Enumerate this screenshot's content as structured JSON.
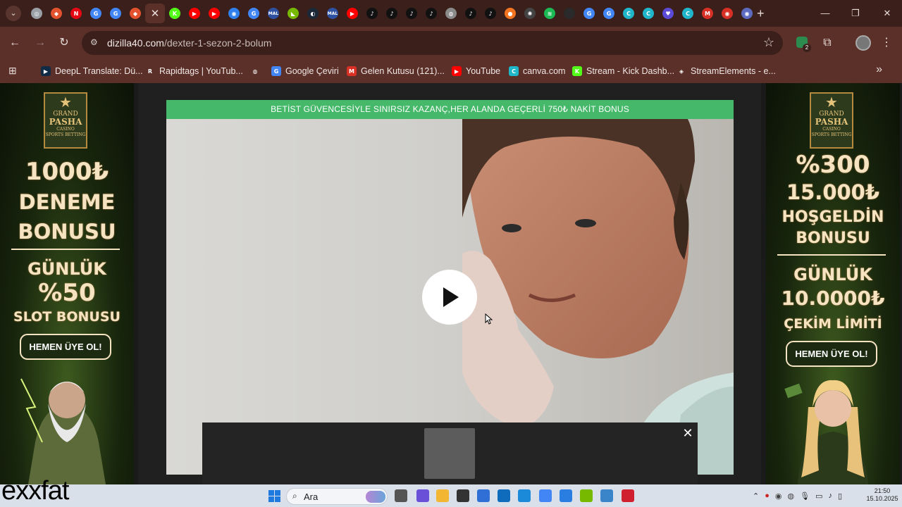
{
  "browser": {
    "tabs": [
      {
        "icon": "chrome-icon",
        "color": "#9aa0a6",
        "glyph": "◎"
      },
      {
        "icon": "game-icon",
        "color": "#e2522f",
        "glyph": "◆"
      },
      {
        "icon": "netflix-icon",
        "color": "#e50914",
        "glyph": "N"
      },
      {
        "icon": "google-icon",
        "color": "#4285f4",
        "glyph": "G"
      },
      {
        "icon": "google-icon",
        "color": "#4285f4",
        "glyph": "G"
      },
      {
        "icon": "game-icon",
        "color": "#e2522f",
        "glyph": "◆"
      },
      {
        "icon": "active-tab-close-icon",
        "color": "#5b3029",
        "glyph": "✕"
      },
      {
        "icon": "kick-icon",
        "color": "#53fc18",
        "glyph": "K"
      },
      {
        "icon": "youtube-icon",
        "color": "#ff0000",
        "glyph": "▶"
      },
      {
        "icon": "youtube-icon",
        "color": "#ff0000",
        "glyph": "▶"
      },
      {
        "icon": "messenger-icon",
        "color": "#2f80ed",
        "glyph": "◉"
      },
      {
        "icon": "google-icon",
        "color": "#4285f4",
        "glyph": "G"
      },
      {
        "icon": "mal-icon",
        "color": "#2e51a2",
        "glyph": "MAL"
      },
      {
        "icon": "nvidia-icon",
        "color": "#76b900",
        "glyph": "◣"
      },
      {
        "icon": "steam-icon",
        "color": "#1b2838",
        "glyph": "◐"
      },
      {
        "icon": "mal-icon",
        "color": "#2e51a2",
        "glyph": "MAL"
      },
      {
        "icon": "youtube-icon",
        "color": "#ff0000",
        "glyph": "▶"
      },
      {
        "icon": "tiktok-icon",
        "color": "#111111",
        "glyph": "♪"
      },
      {
        "icon": "tiktok-icon",
        "color": "#111111",
        "glyph": "♪"
      },
      {
        "icon": "tiktok-icon",
        "color": "#111111",
        "glyph": "♪"
      },
      {
        "icon": "tiktok-icon",
        "color": "#111111",
        "glyph": "♪"
      },
      {
        "icon": "globe-icon",
        "color": "#8a8a8a",
        "glyph": "◍"
      },
      {
        "icon": "tiktok-icon",
        "color": "#111111",
        "glyph": "♪"
      },
      {
        "icon": "tiktok-icon",
        "color": "#111111",
        "glyph": "♪"
      },
      {
        "icon": "crunchy-icon",
        "color": "#f47521",
        "glyph": "●"
      },
      {
        "icon": "openai-icon",
        "color": "#444444",
        "glyph": "✺"
      },
      {
        "icon": "spotify-icon",
        "color": "#1db954",
        "glyph": "≋"
      },
      {
        "icon": "blank-icon",
        "color": "#2a2a2a",
        "glyph": ""
      },
      {
        "icon": "google-icon",
        "color": "#4285f4",
        "glyph": "G"
      },
      {
        "icon": "google-icon",
        "color": "#4285f4",
        "glyph": "G"
      },
      {
        "icon": "canva-icon",
        "color": "#1fb6c9",
        "glyph": "C"
      },
      {
        "icon": "canva-icon",
        "color": "#1fb6c9",
        "glyph": "C"
      },
      {
        "icon": "heart-icon",
        "color": "#5b4bd6",
        "glyph": "♥"
      },
      {
        "icon": "canva-icon",
        "color": "#1fb6c9",
        "glyph": "C"
      },
      {
        "icon": "gmail-icon",
        "color": "#d93025",
        "glyph": "M"
      },
      {
        "icon": "red-circle-icon",
        "color": "#d93025",
        "glyph": "◉"
      },
      {
        "icon": "blue-circle-icon",
        "color": "#5c6bc0",
        "glyph": "◉"
      }
    ],
    "new_tab": "+",
    "window": {
      "minimize": "—",
      "maximize": "❐",
      "close": "✕"
    },
    "url_host": "dizilla40.com",
    "url_path": "/dexter-1-sezon-2-bolum",
    "extension_badge_count": "2",
    "bookmarks": [
      {
        "label": "DeepL Translate: Dü...",
        "icon": "deepl-icon",
        "color": "#0f2b46",
        "glyph": "▶"
      },
      {
        "label": "Rapidtags | YouTub...",
        "icon": "rapidtags-icon",
        "color": "#5b3029",
        "glyph": "R"
      },
      {
        "label": "",
        "icon": "globe-icon",
        "color": "#5b3029",
        "glyph": "◍"
      },
      {
        "label": "Google Çeviri",
        "icon": "google-translate-icon",
        "color": "#4285f4",
        "glyph": "G"
      },
      {
        "label": "Gelen Kutusu (121)...",
        "icon": "gmail-icon",
        "color": "#d93025",
        "glyph": "M"
      },
      {
        "label": "YouTube",
        "icon": "youtube-icon",
        "color": "#ff0000",
        "glyph": "▶"
      },
      {
        "label": "canva.com",
        "icon": "canva-icon",
        "color": "#1fb6c9",
        "glyph": "C"
      },
      {
        "label": "Stream - Kick Dashb...",
        "icon": "kick-icon",
        "color": "#53fc18",
        "glyph": "K"
      },
      {
        "label": "StreamElements - e...",
        "icon": "streamelements-icon",
        "color": "#5b3029",
        "glyph": "◈"
      }
    ]
  },
  "page": {
    "top_banner": "BETİST GÜVENCESİYLE SINIRSIZ KAZANÇ,HER ALANDA GEÇERLİ 750₺ NAKİT BONUS",
    "left_ad": {
      "logo": {
        "l1": "GRAND",
        "l2": "PASHA",
        "l3": "CASINO",
        "l4": "SPORTS BETTING"
      },
      "line1": "1000₺",
      "line2": "DENEME",
      "line3": "BONUSU",
      "line4": "GÜNLÜK",
      "line5": "%50",
      "line6": "SLOT BONUSU",
      "cta": "HEMEN ÜYE OL!"
    },
    "right_ad": {
      "logo": {
        "l1": "GRAND",
        "l2": "PASHA",
        "l3": "CASINO",
        "l4": "SPORTS BETTING"
      },
      "line1": "%300",
      "line2": "15.000₺",
      "line3": "HOŞGELDİN",
      "line4": "BONUSU",
      "line5": "GÜNLÜK",
      "line6": "10.0000₺",
      "line7": "ÇEKİM LİMİTİ",
      "cta": "HEMEN ÜYE OL!"
    }
  },
  "taskbar": {
    "search_label": "Ara",
    "clock_time": "21:50",
    "clock_date": "15.10.2025"
  },
  "watermark": "exxfat"
}
